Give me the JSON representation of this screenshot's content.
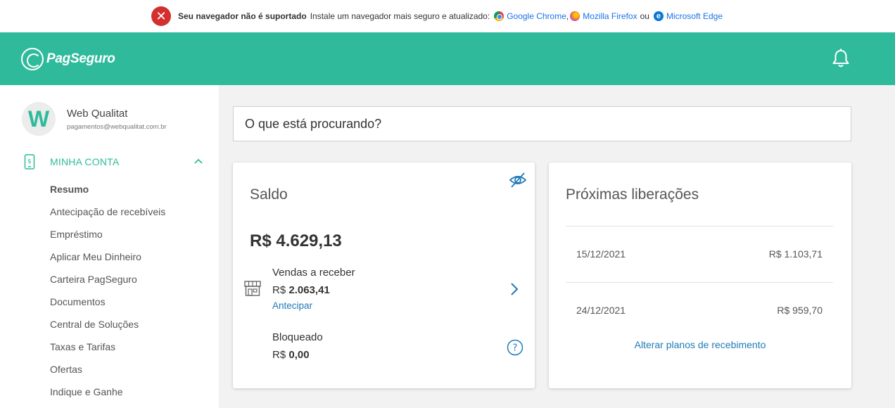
{
  "warning": {
    "title": "Seu navegador não é suportado",
    "text": "Instale um navegador mais seguro e atualizado:",
    "browsers": [
      "Google Chrome",
      "Mozilla Firefox",
      "Microsoft Edge"
    ],
    "comma": ",",
    "or": "ou"
  },
  "header": {
    "brand": "PagSeguro"
  },
  "user": {
    "initial": "W",
    "name": "Web Qualitat",
    "email": "pagamentos@webqualitat.com.br"
  },
  "menu": {
    "section": "MINHA CONTA",
    "items": [
      "Resumo",
      "Antecipação de recebíveis",
      "Empréstimo",
      "Aplicar Meu Dinheiro",
      "Carteira PagSeguro",
      "Documentos",
      "Central de Soluções",
      "Taxas e Tarifas",
      "Ofertas",
      "Indique e Ganhe"
    ]
  },
  "search": {
    "placeholder": "O que está procurando?"
  },
  "saldo": {
    "title": "Saldo",
    "balance": "R$ 4.629,13",
    "vendas_label": "Vendas a receber",
    "currency": "R$",
    "vendas_value": "2.063,41",
    "antecipar": "Antecipar",
    "bloqueado_label": "Bloqueado",
    "bloqueado_value": "0,00"
  },
  "liberacoes": {
    "title": "Próximas liberações",
    "rows": [
      {
        "date": "15/12/2021",
        "amount": "R$ 1.103,71"
      },
      {
        "date": "24/12/2021",
        "amount": "R$ 959,70"
      }
    ],
    "link": "Alterar planos de recebimento"
  },
  "colors": {
    "brand": "#2fbb9b",
    "link": "#1f7bb8",
    "error": "#d32f2f"
  }
}
